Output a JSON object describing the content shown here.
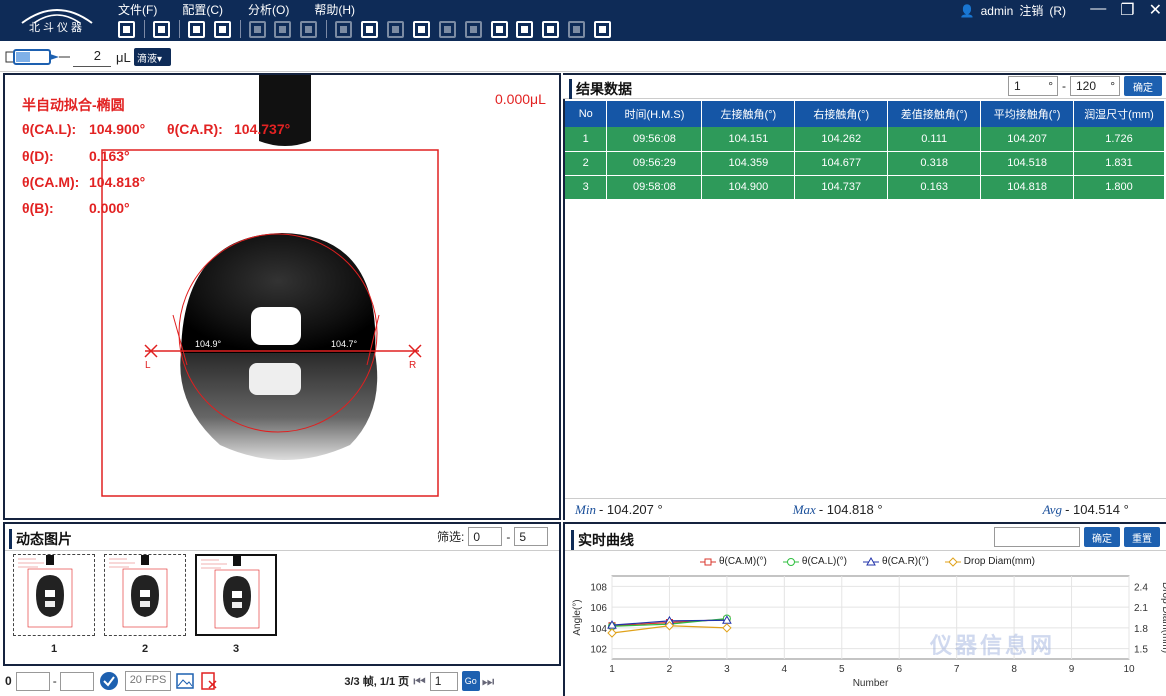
{
  "app": {
    "logo_text": "北斗仪器",
    "menu": [
      "文件(F)",
      "配置(C)",
      "分析(O)",
      "帮助(H)"
    ],
    "user": "admin",
    "logout_label": "注销",
    "logout_shortcut": "(R)",
    "window_controls": {
      "minimize": "—",
      "restore": "❐",
      "close": "✕"
    }
  },
  "dispense": {
    "volume": "2",
    "unit": "μL",
    "drop_button": "滴液▾"
  },
  "image_panel": {
    "fit_mode": "半自动拟合-椭圆",
    "volume_readout": "0.000μL",
    "ca_l_label": "θ(CA.L):",
    "ca_l": "104.900°",
    "ca_r_label": "θ(CA.R):",
    "ca_r": "104.737°",
    "d_label": "θ(D):",
    "d": "0.163°",
    "ca_m_label": "θ(CA.M):",
    "ca_m": "104.818°",
    "b_label": "θ(B):",
    "b": "0.000°",
    "left_angle": "104.9°",
    "right_angle": "104.7°",
    "left_marker": "L",
    "right_marker": "R"
  },
  "results": {
    "title": "结果数据",
    "range_from": "1",
    "range_from_unit": "°",
    "range_sep": "-",
    "range_to": "120",
    "range_to_unit": "°",
    "confirm": "确定",
    "columns": [
      "No",
      "时间(H.M.S)",
      "左接触角(°)",
      "右接触角(°)",
      "差值接触角(°)",
      "平均接触角(°)",
      "润湿尺寸(mm)"
    ],
    "rows": [
      [
        "1",
        "09:56:08",
        "104.151",
        "104.262",
        "0.111",
        "104.207",
        "1.726"
      ],
      [
        "2",
        "09:56:29",
        "104.359",
        "104.677",
        "0.318",
        "104.518",
        "1.831"
      ],
      [
        "3",
        "09:58:08",
        "104.900",
        "104.737",
        "0.163",
        "104.818",
        "1.800"
      ]
    ],
    "min_label": "Min",
    "min": "- 104.207 °",
    "max_label": "Max",
    "max": "- 104.818 °",
    "avg_label": "Avg",
    "avg": "- 104.514 °"
  },
  "dynamic": {
    "title": "动态图片",
    "filter_label": "筛选:",
    "filter_from": "0",
    "filter_sep": "-",
    "filter_to": "5",
    "thumbs": [
      "1",
      "2",
      "3"
    ],
    "frame_start": "0",
    "frame_sep": "-",
    "fps": "20 FPS",
    "frame_info": "3/3 帧, 1/1 页",
    "page": "1",
    "go": "Go"
  },
  "curve": {
    "title": "实时曲线",
    "confirm": "确定",
    "reset": "重置",
    "watermark": "仪器信息网"
  },
  "chart_data": {
    "type": "line",
    "x": [
      1,
      2,
      3
    ],
    "series": [
      {
        "name": "θ(CA.M)(°)",
        "values": [
          104.207,
          104.518,
          104.818
        ],
        "color": "#d9342b",
        "marker": "square",
        "axis": "left"
      },
      {
        "name": "θ(CA.L)(°)",
        "values": [
          104.151,
          104.359,
          104.9
        ],
        "color": "#2fbf3f",
        "marker": "circle",
        "axis": "left"
      },
      {
        "name": "θ(CA.R)(°)",
        "values": [
          104.262,
          104.677,
          104.737
        ],
        "color": "#2233aa",
        "marker": "triangle",
        "axis": "left"
      },
      {
        "name": "Drop Diam(mm)",
        "values": [
          1.726,
          1.831,
          1.8
        ],
        "color": "#e0a21a",
        "marker": "diamond",
        "axis": "right"
      }
    ],
    "xlabel": "Number",
    "ylabel": "Angle(°)",
    "y2label": "Drop Diam(mm)",
    "xlim": [
      1,
      10
    ],
    "xticks": [
      "1",
      "2",
      "3",
      "4",
      "5",
      "6",
      "7",
      "8",
      "9",
      "10"
    ],
    "ylim": [
      101,
      109
    ],
    "yticks": [
      "102",
      "104",
      "106",
      "108"
    ],
    "y2lim": [
      1.35,
      2.55
    ],
    "y2ticks": [
      "1.5",
      "1.8",
      "2.1",
      "2.4"
    ],
    "grid": true,
    "legend": "top"
  }
}
